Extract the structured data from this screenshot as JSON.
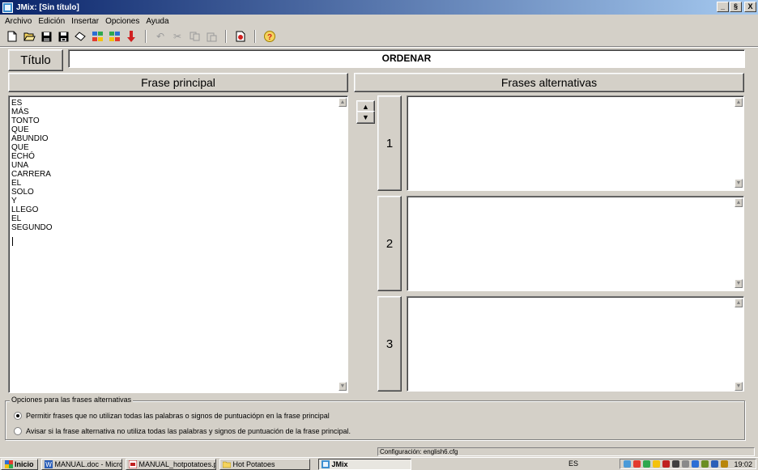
{
  "window": {
    "title": "JMix: [Sin título]",
    "minimize": "_",
    "maximize": "§",
    "close": "X"
  },
  "menu": [
    "Archivo",
    "Edición",
    "Insertar",
    "Opciones",
    "Ayuda"
  ],
  "toolbar": {
    "icons": [
      "new-icon",
      "open-icon",
      "save-icon",
      "save-as-icon",
      "erase-icon",
      "web-page-icon",
      "web-page-dhtml-icon",
      "drag-drop-icon",
      "undo-icon",
      "cut-icon",
      "copy-icon",
      "paste-icon",
      "config-icon",
      "help-icon"
    ]
  },
  "title_button": "Título",
  "title_value": "ORDENAR",
  "headers": {
    "main": "Frase principal",
    "alternatives": "Frases alternativas"
  },
  "main_sentence": [
    "ES",
    "MÁS",
    "TONTO",
    "QUE",
    "ABUNDIO",
    "QUE",
    "ECHÓ",
    "UNA",
    "CARRERA",
    "EL",
    "SOLO",
    "Y",
    "LLEGO",
    "EL",
    "SEGUNDO"
  ],
  "move_buttons": {
    "up": "▲",
    "down": "▼"
  },
  "alternatives": [
    {
      "number": "1",
      "text": ""
    },
    {
      "number": "2",
      "text": ""
    },
    {
      "number": "3",
      "text": ""
    }
  ],
  "options": {
    "legend": "Opciones para las frases alternativas",
    "radio1": {
      "label": "Permitir frases que no utilizan todas las palabras o signos de puntuaciópn en la frase principal",
      "checked": true
    },
    "radio2": {
      "label": "Avisar si la frase alternativa no utiliza todas las palabras y signos de puntuación de la frase principal.",
      "checked": false
    }
  },
  "status": "Configuración: english6.cfg",
  "taskbar": {
    "start": "Inicio",
    "tasks": [
      {
        "label": "MANUAL.doc - Microsoft ...",
        "icon": "word-icon"
      },
      {
        "label": "MANUAL_hotpotatoes.p...",
        "icon": "pdf-icon"
      },
      {
        "label": "Hot Potatoes",
        "icon": "folder-icon"
      },
      {
        "label": "JMix",
        "icon": "jmix-icon",
        "active": true
      }
    ],
    "language": "ES",
    "clock": "19:02"
  },
  "colors": {
    "titlebar_start": "#0a246a",
    "titlebar_end": "#a6caf0",
    "face": "#d4d0c8"
  }
}
